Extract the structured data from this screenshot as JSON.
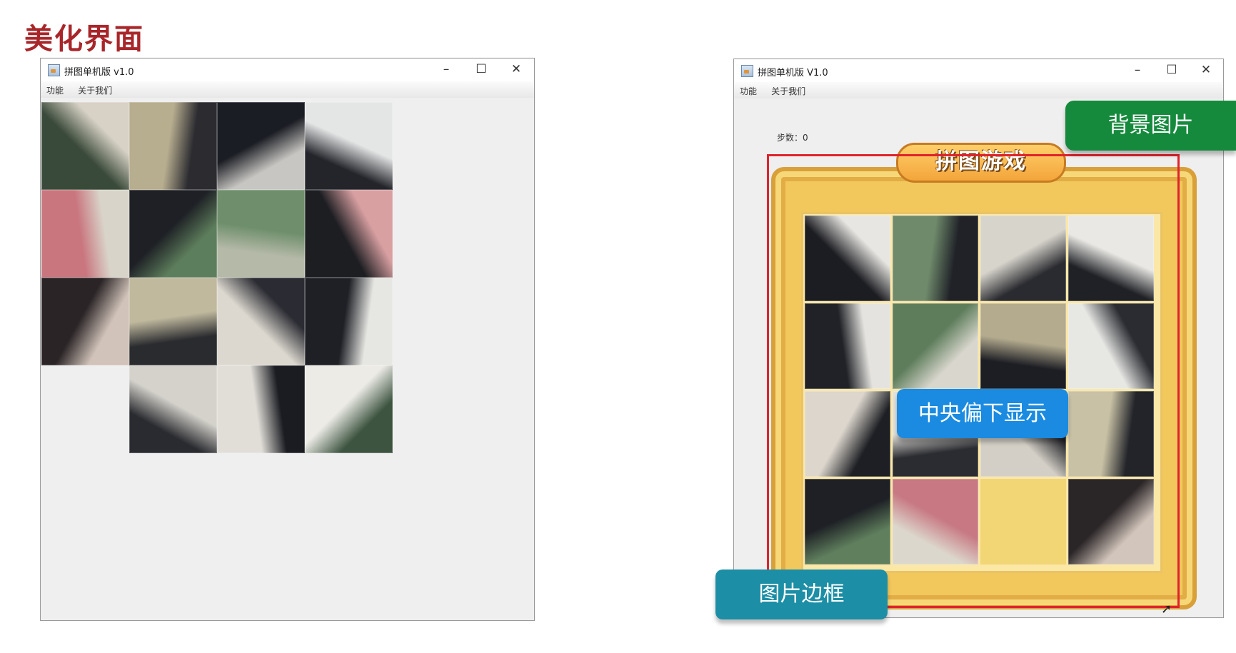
{
  "slide": {
    "title": "美化界面"
  },
  "left_window": {
    "title": "拼图单机版 v1.0",
    "menus": [
      "功能",
      "关于我们"
    ],
    "controls": {
      "minimize": "–",
      "maximize": "☐",
      "close": "✕"
    },
    "tiles": [
      {
        "row": 0,
        "col": 0,
        "colors": [
          "#3a4a3a",
          "#d8d2c6"
        ]
      },
      {
        "row": 0,
        "col": 1,
        "colors": [
          "#b7ad8f",
          "#2b2b30"
        ]
      },
      {
        "row": 0,
        "col": 2,
        "colors": [
          "#1b1d24",
          "#c8c6c2"
        ]
      },
      {
        "row": 0,
        "col": 3,
        "colors": [
          "#e4e6e6",
          "#23252b"
        ]
      },
      {
        "row": 1,
        "col": 0,
        "colors": [
          "#c9767f",
          "#d9d4c9"
        ]
      },
      {
        "row": 1,
        "col": 1,
        "colors": [
          "#1e2025",
          "#5d7e5c"
        ]
      },
      {
        "row": 1,
        "col": 2,
        "colors": [
          "#6f8f6c",
          "#b5b9a8"
        ]
      },
      {
        "row": 1,
        "col": 3,
        "colors": [
          "#1d1e22",
          "#d9a0a2"
        ]
      },
      {
        "row": 2,
        "col": 0,
        "colors": [
          "#2a2426",
          "#d1c3b9"
        ]
      },
      {
        "row": 2,
        "col": 1,
        "colors": [
          "#c0b99e",
          "#2a2b2f"
        ]
      },
      {
        "row": 2,
        "col": 2,
        "colors": [
          "#dcd8cf",
          "#2b2c33"
        ]
      },
      {
        "row": 2,
        "col": 3,
        "colors": [
          "#1e2026",
          "#e6e6e2"
        ]
      },
      {
        "row": 3,
        "col": 1,
        "colors": [
          "#d4d2cb",
          "#2a2b30"
        ]
      },
      {
        "row": 3,
        "col": 2,
        "colors": [
          "#e1ded8",
          "#1a1c22"
        ]
      },
      {
        "row": 3,
        "col": 3,
        "colors": [
          "#ecebe6",
          "#3d5440"
        ]
      }
    ]
  },
  "right_window": {
    "title": "拼图单机版 V1.0",
    "menus": [
      "功能",
      "关于我们"
    ],
    "controls": {
      "minimize": "–",
      "maximize": "☐",
      "close": "✕"
    },
    "steps": "步数：0",
    "logo": "拼图游戏",
    "tiles": [
      {
        "row": 0,
        "col": 0,
        "colors": [
          "#1c1d22",
          "#e7e6e2"
        ]
      },
      {
        "row": 0,
        "col": 1,
        "colors": [
          "#6f8a6b",
          "#202228"
        ]
      },
      {
        "row": 0,
        "col": 2,
        "colors": [
          "#d7d4cc",
          "#2a2b30"
        ]
      },
      {
        "row": 0,
        "col": 3,
        "colors": [
          "#e9e8e4",
          "#1f2126"
        ]
      },
      {
        "row": 1,
        "col": 0,
        "colors": [
          "#202227",
          "#e4e3df"
        ]
      },
      {
        "row": 1,
        "col": 1,
        "colors": [
          "#5e7d5b",
          "#d8d6cd"
        ]
      },
      {
        "row": 1,
        "col": 2,
        "colors": [
          "#b4ab8e",
          "#1d1e24"
        ]
      },
      {
        "row": 1,
        "col": 3,
        "colors": [
          "#e7e7e4",
          "#2a2c32"
        ]
      },
      {
        "row": 2,
        "col": 0,
        "colors": [
          "#dcd6cd",
          "#1d1f24"
        ]
      },
      {
        "row": 2,
        "col": 1,
        "colors": [
          "#e3e1dc",
          "#2b2c31"
        ]
      },
      {
        "row": 2,
        "col": 2,
        "colors": [
          "#d3cfc6",
          "#1f2025"
        ]
      },
      {
        "row": 2,
        "col": 3,
        "colors": [
          "#c8c1a5",
          "#22242a"
        ]
      },
      {
        "row": 3,
        "col": 0,
        "colors": [
          "#1e2025",
          "#5f7f5d"
        ]
      },
      {
        "row": 3,
        "col": 1,
        "colors": [
          "#c77882",
          "#dcd7cc"
        ]
      },
      {
        "row": 3,
        "col": 2,
        "colors": [
          "#f2d676",
          "#f2d676"
        ],
        "empty": true
      },
      {
        "row": 3,
        "col": 3,
        "colors": [
          "#2a2527",
          "#d2c5bb"
        ]
      }
    ]
  },
  "annotations": {
    "background": "背景图片",
    "center_lower": "中央偏下显示",
    "frame": "图片边框"
  }
}
